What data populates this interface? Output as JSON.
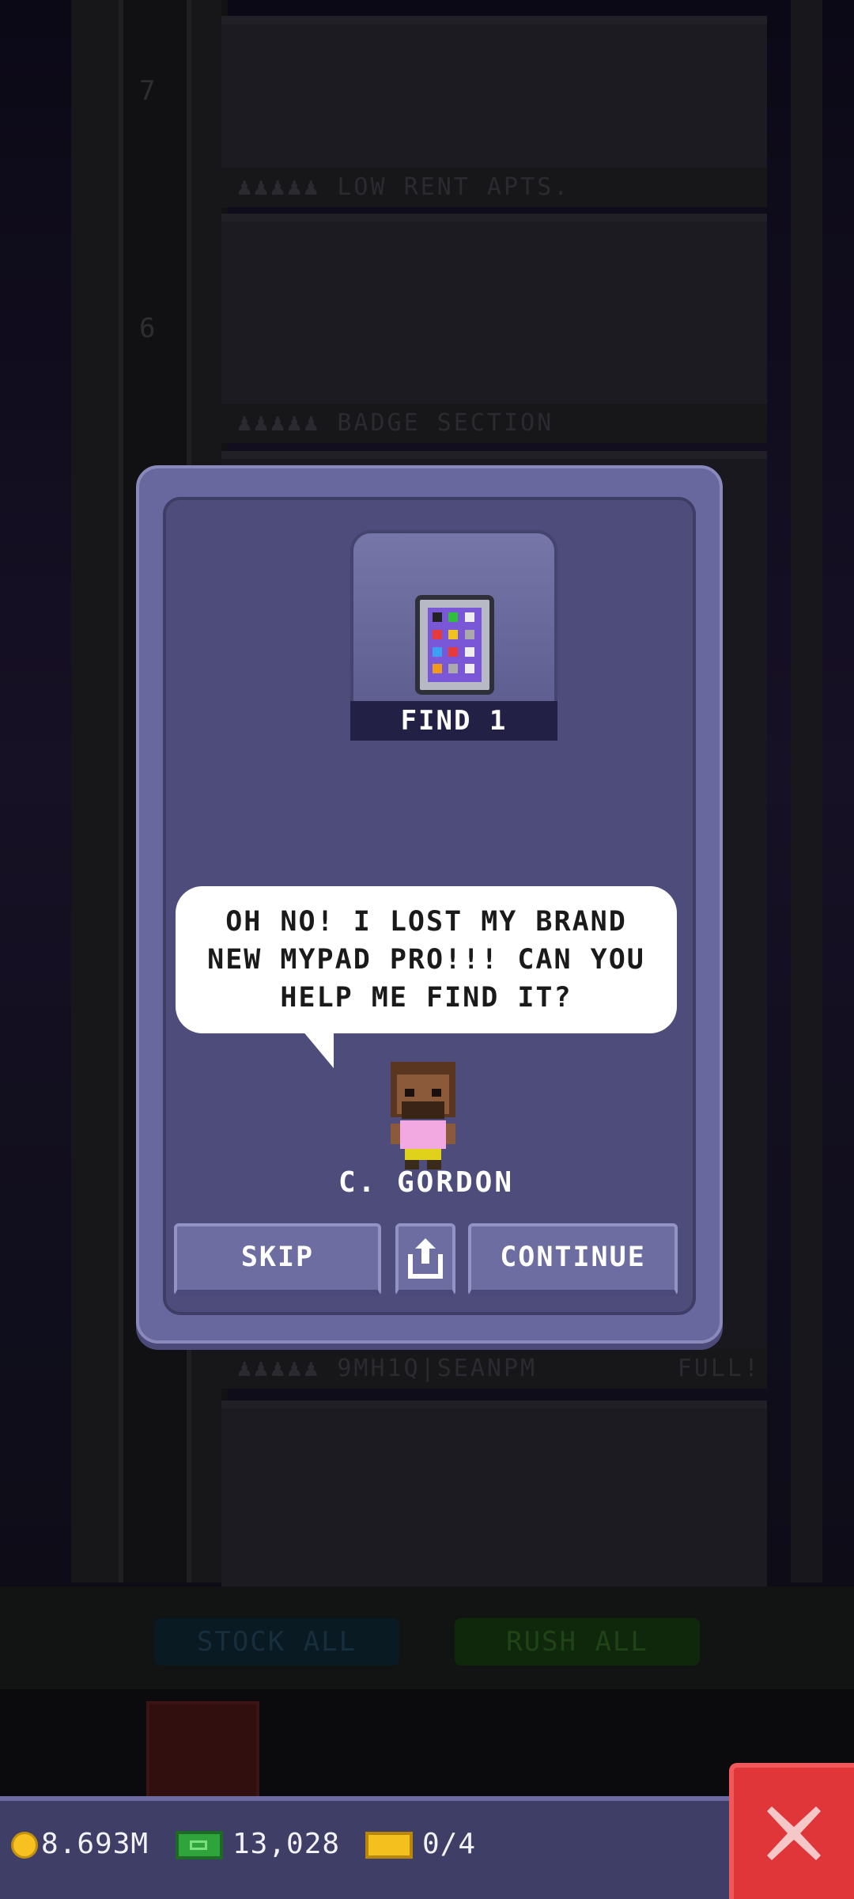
{
  "background": {
    "floors": [
      {
        "number": "7",
        "label": "LOW RENT APTS."
      },
      {
        "number": "6",
        "label": "BADGE SECTION"
      },
      {
        "number": "",
        "label": "9MH1Q|SEANPM",
        "status": "FULL!"
      }
    ],
    "stock_all_label": "STOCK ALL",
    "rush_all_label": "RUSH ALL"
  },
  "mission": {
    "item_icon": "tablet-icon",
    "find_label": "FIND 1",
    "message": "OH NO! I LOST MY BRAND NEW MYPAD PRO!!! CAN YOU HELP ME FIND IT?",
    "character_name": "C. GORDON"
  },
  "buttons": {
    "skip": "SKIP",
    "share_icon": "share-icon",
    "continue": "CONTINUE"
  },
  "status_bar": {
    "coins": "8.693M",
    "tower_bux": "13,028",
    "tickets": "0/4",
    "close_icon": "close-icon"
  },
  "colors": {
    "dialog_bg": "#4d4c7a",
    "dialog_border": "#68689e",
    "close_red": "#e0363a",
    "status_bar": "#3f3e66"
  }
}
